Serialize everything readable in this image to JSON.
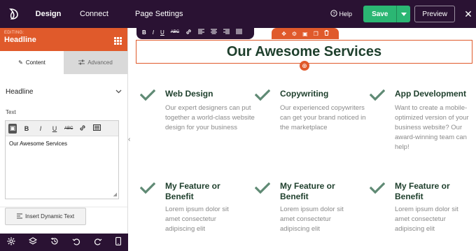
{
  "topbar": {
    "tabs": [
      "Design",
      "Connect",
      "Page Settings"
    ],
    "help": "Help",
    "save": "Save",
    "preview": "Preview"
  },
  "panel": {
    "editing_label": "EDITING:",
    "editing_name": "Headline",
    "tab_content": "Content",
    "tab_advanced": "Advanced",
    "section": "Headline",
    "text_label": "Text",
    "editor_value": "Our Awesome Services",
    "dynamic_button": "Insert Dynamic Text"
  },
  "page": {
    "headline": "Our Awesome Services",
    "features": [
      {
        "title": "Web Design",
        "desc": "Our expert designers can put together a world-class website design for your business"
      },
      {
        "title": "Copywriting",
        "desc": "Our experienced copywriters can get your brand noticed in the marketplace"
      },
      {
        "title": "App Development",
        "desc": "Want to create a mobile-optimized version of your business website? Our award-winning team can help!"
      },
      {
        "title": "My Feature or Benefit",
        "desc": "Lorem ipsum dolor sit amet  consectetur adipiscing elit"
      },
      {
        "title": "My Feature or Benefit",
        "desc": "Lorem ipsum dolor sit amet  consectetur adipiscing elit"
      },
      {
        "title": "My Feature or Benefit",
        "desc": "Lorem ipsum dolor sit amet  consectetur adipiscing elit"
      }
    ]
  },
  "colors": {
    "topbar": "#2a1233",
    "accent": "#e05a2b",
    "save": "#2bb673",
    "heading": "#1e3f2c",
    "check": "#5f8a74"
  }
}
